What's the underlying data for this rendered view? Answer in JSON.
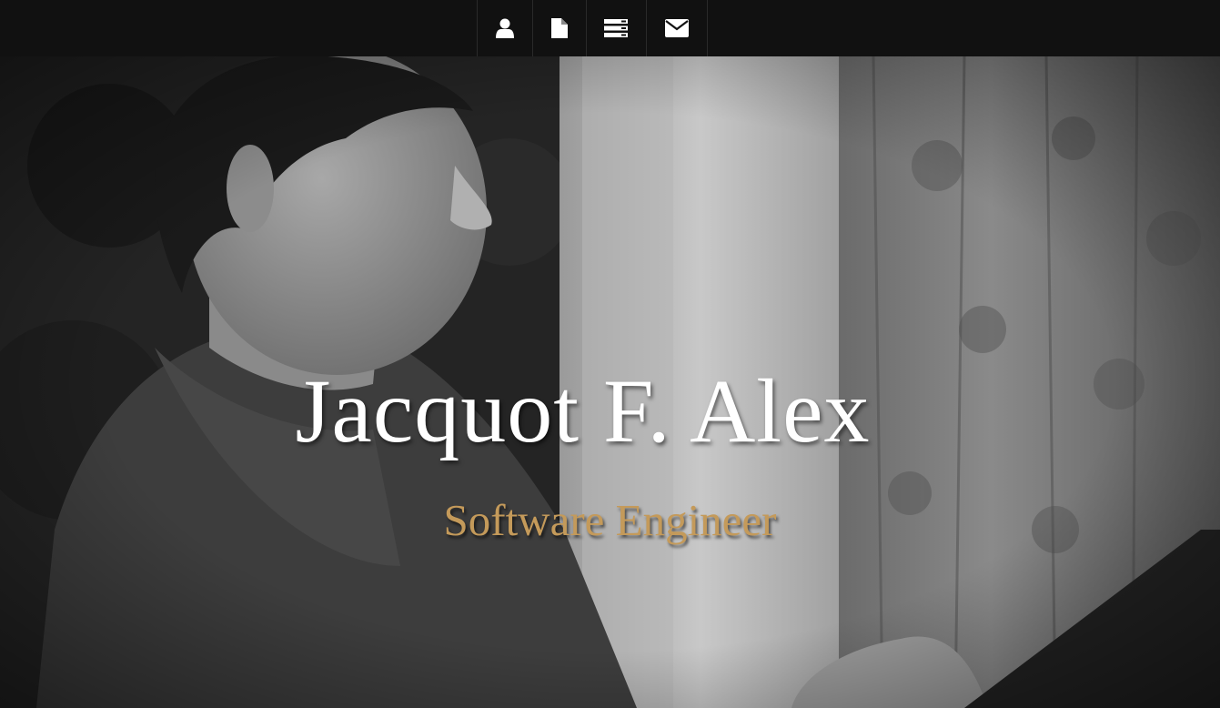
{
  "nav": {
    "items": [
      {
        "icon": "user-icon"
      },
      {
        "icon": "document-icon"
      },
      {
        "icon": "server-icon"
      },
      {
        "icon": "envelope-icon"
      }
    ]
  },
  "hero": {
    "name": "Jacquot F. Alex",
    "subtitle": "Software Engineer"
  },
  "colors": {
    "nav_background": "#111111",
    "name_color": "#ffffff",
    "subtitle_color": "#c49a5a"
  }
}
